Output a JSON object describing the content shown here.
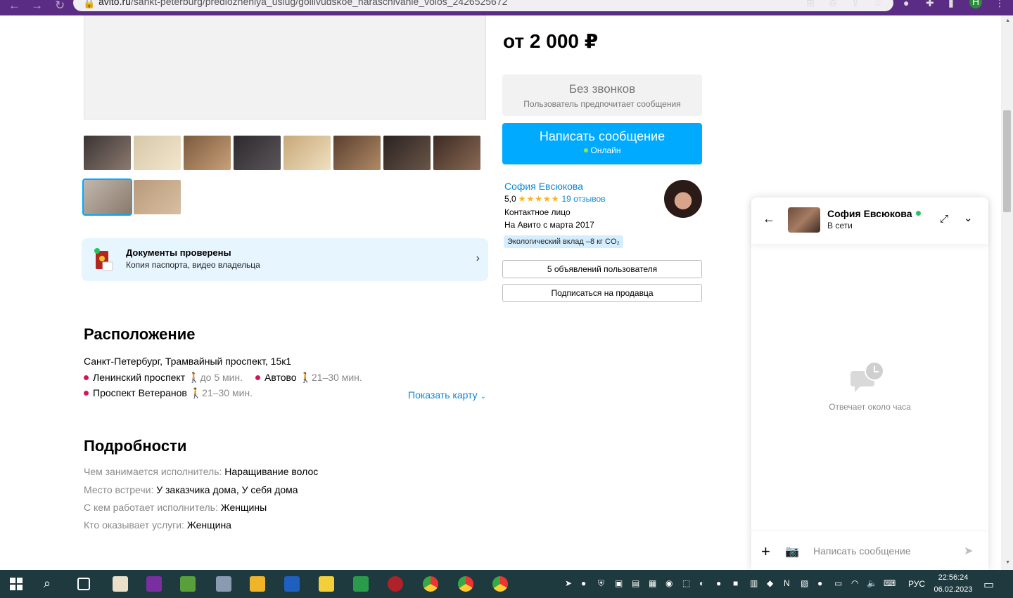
{
  "browser": {
    "url_host": "avito.ru",
    "url_path": "/sankt-peterburg/predlozheniya_uslug/gollivudskoe_naraschivanie_volos_2426525672"
  },
  "listing": {
    "price": "от 2 000 ₽",
    "no_calls_title": "Без звонков",
    "no_calls_sub": "Пользователь предпочитает сообщения",
    "write_button": "Написать сообщение",
    "write_button_status": "Онлайн"
  },
  "seller": {
    "name": "София Евсюкова",
    "rating": "5,0",
    "stars": "★★★★★",
    "reviews": "19 отзывов",
    "role": "Контактное лицо",
    "since": "На Авито с марта 2017",
    "eco": "Экологический вклад –8 кг CO₂",
    "listings_button": "5 объявлений пользователя",
    "subscribe_button": "Подписаться на продавца"
  },
  "gallery": {
    "thumbnails": [
      {
        "colors": [
          "#3a3433",
          "#8c7a70"
        ]
      },
      {
        "colors": [
          "#d6c7a8",
          "#f2e6cc"
        ]
      },
      {
        "colors": [
          "#7a5a3c",
          "#c9a07a"
        ]
      },
      {
        "colors": [
          "#2c2a2c",
          "#5a555a"
        ]
      },
      {
        "colors": [
          "#c8a878",
          "#efe0c0"
        ]
      },
      {
        "colors": [
          "#5a3f2e",
          "#b08a66"
        ]
      },
      {
        "colors": [
          "#2a2220",
          "#6a5548"
        ]
      },
      {
        "colors": [
          "#3c2a22",
          "#8a6a55"
        ]
      },
      {
        "colors": [
          "#c2b8b0",
          "#8a7a6a"
        ]
      },
      {
        "colors": [
          "#b89a7a",
          "#d8bfa2"
        ]
      }
    ]
  },
  "documents": {
    "title": "Документы проверены",
    "subtitle": "Копия паспорта, видео владельца"
  },
  "location": {
    "heading": "Расположение",
    "address": "Санкт-Петербург, Трамвайный проспект, 15к1",
    "metro": [
      {
        "name": "Ленинский проспект",
        "time": "до 5 мин."
      },
      {
        "name": "Автово",
        "time": "21–30 мин."
      },
      {
        "name": "Проспект Ветеранов",
        "time": "21–30 мин."
      }
    ],
    "show_map": "Показать карту"
  },
  "details": {
    "heading": "Подробности",
    "rows": [
      {
        "k": "Чем занимается исполнитель:",
        "v": "Наращивание волос"
      },
      {
        "k": "Место встречи:",
        "v": "У заказчика дома, У себя дома"
      },
      {
        "k": "С кем работает исполнитель:",
        "v": "Женщины"
      },
      {
        "k": "Кто оказывает услуги:",
        "v": "Женщина"
      }
    ]
  },
  "chat": {
    "name": "София Евсюкова",
    "status": "В сети",
    "replies": "Отвечает около часа",
    "input_placeholder": "Написать сообщение"
  },
  "taskbar": {
    "lang": "РУС",
    "time": "22:56:24",
    "date": "06.02.2023"
  },
  "colors": {
    "accent": "#00aaff",
    "link": "#0a88d6",
    "metro_dot": "#d8125d",
    "online": "#97e64c",
    "browser_bar": "#5b2c84"
  }
}
